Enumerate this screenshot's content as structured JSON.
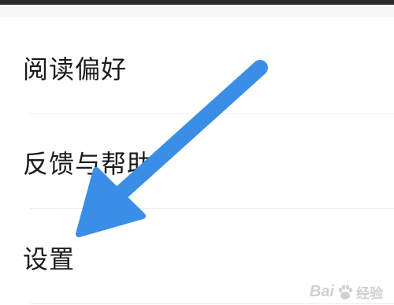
{
  "menu": {
    "items": [
      {
        "label": "阅读偏好"
      },
      {
        "label": "反馈与帮助"
      },
      {
        "label": "设置"
      }
    ]
  },
  "annotation": {
    "arrow_color": "#3a8ee6",
    "icon": "arrow-pointer-icon"
  },
  "watermark": {
    "text_prefix": "Bai",
    "text_suffix": "经验",
    "icon": "baidu-paw-icon"
  }
}
